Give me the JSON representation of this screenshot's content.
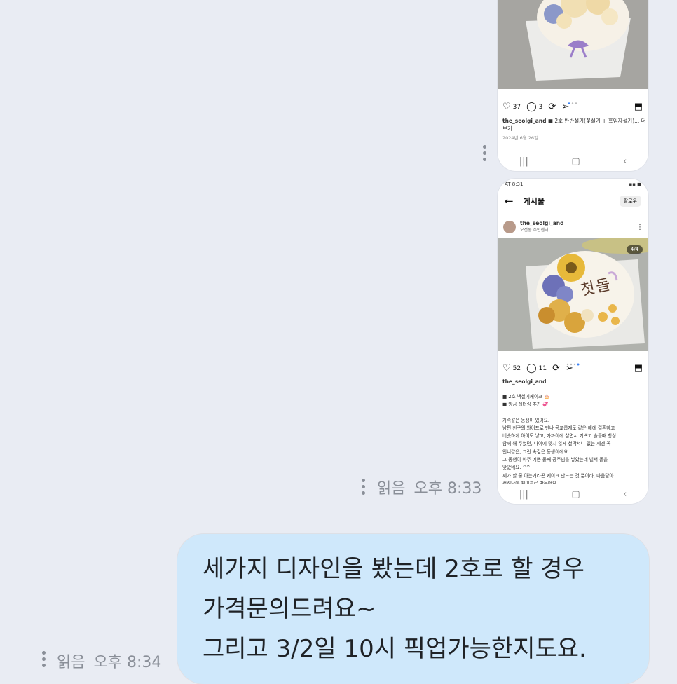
{
  "post1": {
    "likes": "37",
    "comments": "3",
    "username": "the_seolgi_and",
    "caption_snippet": "■ 2호 반반설기(꽃설기 + 흑임자설기)... 더",
    "more_text": "보기",
    "date": "2024년 6월 26일"
  },
  "post2": {
    "status_time": "AT 8:31",
    "header_title": "게시물",
    "follow_label": "팔로우",
    "username": "the_seolgi_and",
    "location": "오전동 주민센터",
    "page_indicator": "4/4",
    "cake_text": "첫돌",
    "likes": "52",
    "comments": "11",
    "caption_user": "the_seolgi_and",
    "caption_lines": [
      "■ 2호 백설기케이크 🎂",
      "■ 앙금 레터링 추가 💞",
      "",
      "가족같은 동생이 있어요.",
      "남편 친구의 와이프로 만나 공교롭게도 같은 해에 결혼하고",
      "비슷하게 아이도 낳고, 가까이에 살면서 기쁘고 슬플때 항상",
      "함께 해 주었던, 나이에 맞지 않게 철딱서니 없는 제겐 꼭",
      "언니같은, 그런 속깊은 동생이에요.",
      "그 동생이 아주 예쁜 둘째 공주님을 낳았는데 벌써 돌을",
      "맞았네요. ^^",
      "제가 할 줄 아는거라곤 케이크 만드는 것 뿐이라, 마음담아",
      "정성담아 케이크로 만들어요"
    ]
  },
  "read_status_1": {
    "read": "읽음",
    "time": "오후 8:33"
  },
  "read_status_2": {
    "read": "읽음",
    "time": "오후 8:34"
  },
  "message": {
    "lines": [
      "세가지 디자인을 봤는데 2호로 할 경우",
      "가격문의드려요~",
      "그리고 3/2일 10시 픽업가능한지도요."
    ]
  },
  "colors": {
    "background": "#e9ecf3",
    "bubble": "#cfe8fb",
    "meta_text": "#8a8f98"
  }
}
